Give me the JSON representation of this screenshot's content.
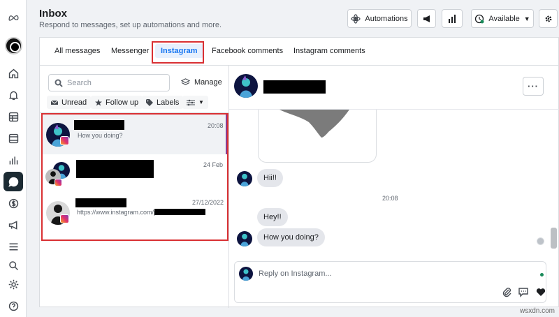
{
  "header": {
    "title": "Inbox",
    "subtitle": "Respond to messages, set up automations and more.",
    "automations_label": "Automations",
    "status_label": "Available"
  },
  "tabs": [
    {
      "label": "All messages"
    },
    {
      "label": "Messenger"
    },
    {
      "label": "Instagram",
      "active": true
    },
    {
      "label": "Facebook comments"
    },
    {
      "label": "Instagram comments"
    }
  ],
  "search": {
    "placeholder": "Search"
  },
  "manage_label": "Manage",
  "filters": {
    "unread": "Unread",
    "follow_up": "Follow up",
    "labels": "Labels"
  },
  "conversations": [
    {
      "time": "20:08",
      "preview": "How you doing?"
    },
    {
      "time": "24 Feb",
      "preview": ""
    },
    {
      "time": "27/12/2022",
      "preview": "https://www.instagram.com/p/"
    }
  ],
  "messages": [
    {
      "from": "contact",
      "text": "Hii!!"
    },
    {
      "from": "timestamp",
      "text": "20:08"
    },
    {
      "from": "contact",
      "text": "Hey!!"
    },
    {
      "from": "contact",
      "text": "How you doing?"
    }
  ],
  "reply": {
    "placeholder": "Reply on Instagram..."
  },
  "watermark": "wsxdn.com",
  "colors": {
    "accent": "#1877f2",
    "highlight": "#d93033",
    "rail_active": "#1c2b33"
  }
}
